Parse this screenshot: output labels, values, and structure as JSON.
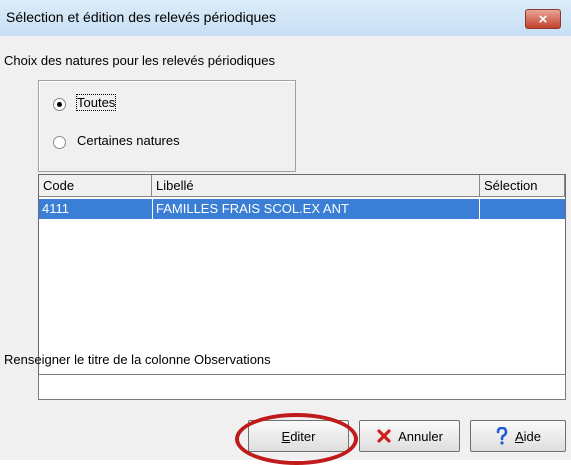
{
  "window": {
    "title": "Sélection et édition des relevés périodiques",
    "close_glyph": "×"
  },
  "natures": {
    "heading": "Choix des natures pour les relevés périodiques",
    "options": [
      {
        "label": "Toutes",
        "checked": true
      },
      {
        "label": "Certaines natures",
        "checked": false
      }
    ]
  },
  "grid": {
    "columns": [
      "Code",
      "Libellé",
      "Sélection"
    ],
    "rows": [
      {
        "code": "4111",
        "libelle": "FAMILLES FRAIS SCOL.EX ANT",
        "selection": ""
      }
    ],
    "selected_row_color": "#3a7fd5"
  },
  "observations": {
    "label": "Renseigner le titre de la colonne Observations",
    "value": ""
  },
  "buttons": {
    "editer": "Editer",
    "annuler": "Annuler",
    "aide": "Aide"
  },
  "colors": {
    "highlight_circle": "#c01a1a",
    "cancel_icon": "#d21f1f",
    "help_icon": "#1e5bd6"
  }
}
